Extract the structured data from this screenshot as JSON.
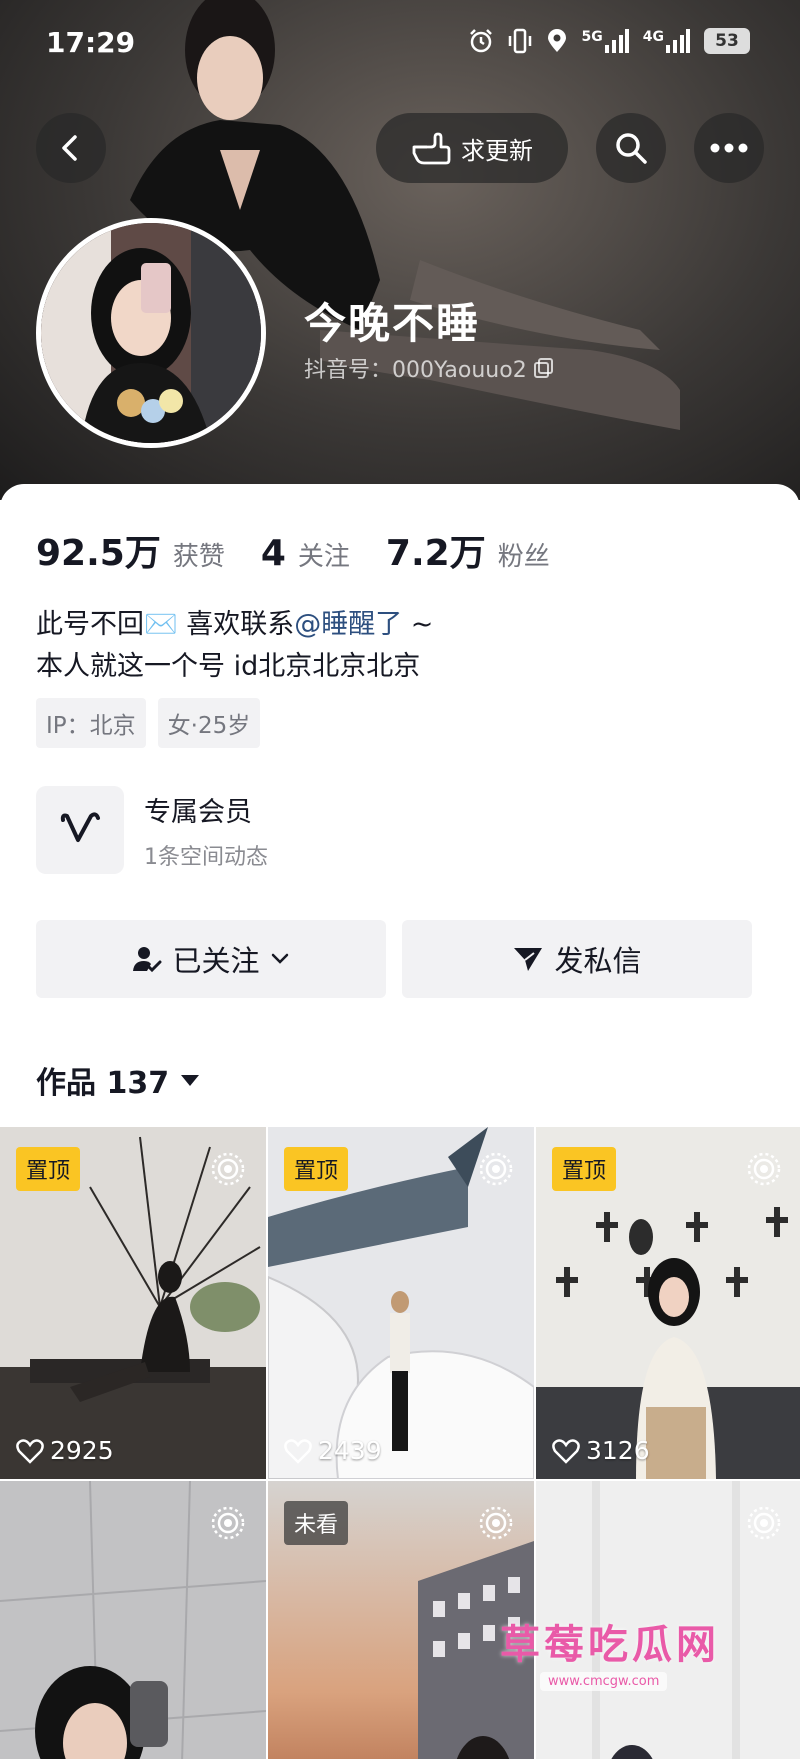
{
  "status_bar": {
    "time": "17:29",
    "signal_5g": "5G",
    "signal_4g": "4G",
    "battery": "53"
  },
  "header": {
    "request_update_label": "求更新",
    "nickname": "今晚不睡",
    "douyin_id": "抖音号：000Yaouuo2"
  },
  "stats": [
    {
      "value": "92.5万",
      "label": "获赞"
    },
    {
      "value": "4",
      "label": "关注"
    },
    {
      "value": "7.2万",
      "label": "粉丝"
    }
  ],
  "bio": {
    "line1_prefix": "此号不回✉️ 喜欢联系",
    "line1_mention": "@睡醒了",
    "line1_suffix": " ~",
    "line2": "本人就这一个号  id北京北京北京"
  },
  "tags": [
    "IP：北京",
    "女·25岁"
  ],
  "member": {
    "title": "专属会员",
    "subtitle": "1条空间动态"
  },
  "actions": {
    "followed_label": "已关注",
    "message_label": "发私信"
  },
  "works_tab": {
    "label": "作品 137"
  },
  "grid": {
    "pinned_label": "置顶",
    "unseen_label": "未看",
    "tiles": [
      {
        "likes": "2925"
      },
      {
        "likes": "2439"
      },
      {
        "likes": "3126"
      },
      {
        "likes": ""
      },
      {
        "likes": ""
      },
      {
        "likes": ""
      }
    ]
  },
  "watermark": {
    "text": "草莓吃瓜网",
    "url": "www.cmcgw.com"
  },
  "colors": {
    "accent_pin": "#fac523",
    "mention": "#2d4f7f",
    "watermark": "#e95aa8"
  }
}
